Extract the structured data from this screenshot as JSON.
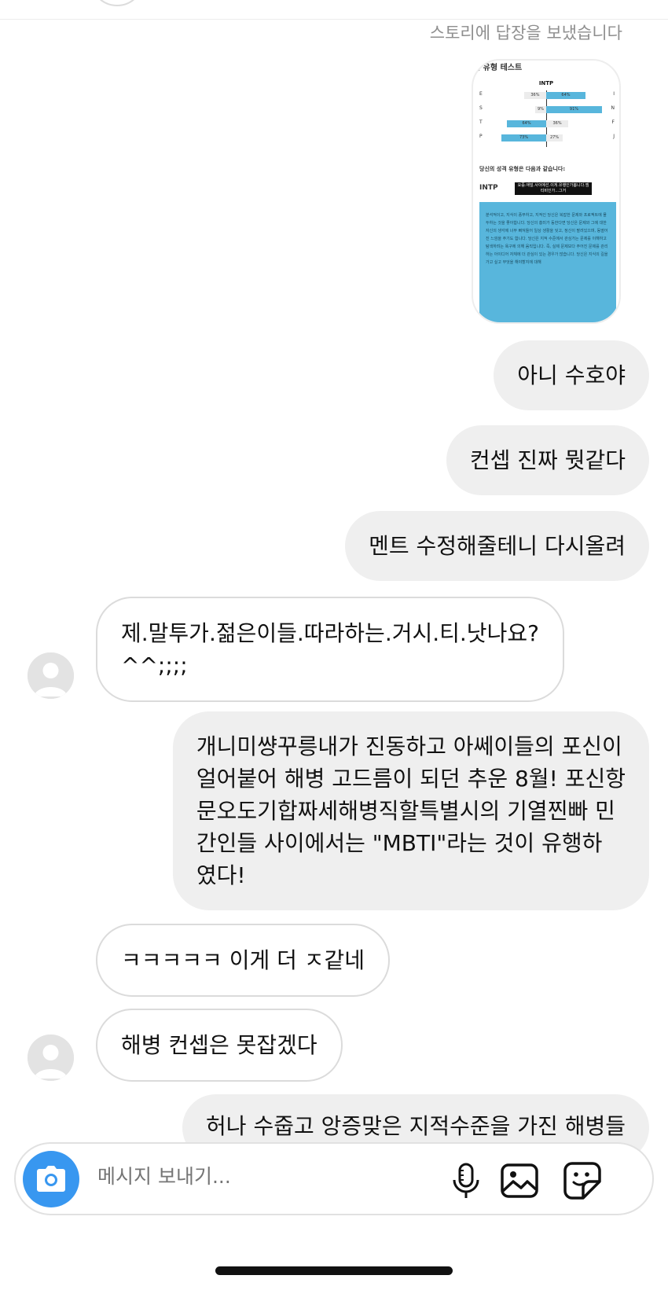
{
  "header": {
    "story_reply_note": "스토리에 답장을 보냈습니다"
  },
  "story_card": {
    "title": "격 유형 테스트",
    "type_label": "INTP",
    "rows": [
      {
        "left": "E",
        "right": "I",
        "left_pct": "36%",
        "right_pct": "64%",
        "left_val": 36,
        "right_val": 64,
        "dominant": "right"
      },
      {
        "left": "S",
        "right": "N",
        "left_pct": "9%",
        "right_pct": "91%",
        "left_val": 9,
        "right_val": 91,
        "dominant": "right"
      },
      {
        "left": "T",
        "right": "F",
        "left_pct": "64%",
        "right_pct": "36%",
        "left_val": 64,
        "right_val": 36,
        "dominant": "left"
      },
      {
        "left": "P",
        "right": "J",
        "left_pct": "73%",
        "right_pct": "27%",
        "left_val": 73,
        "right_val": 27,
        "dominant": "left"
      }
    ],
    "result_heading": "당신의 성격 유형은 다음과 같습니다:",
    "result_type": "INTP",
    "result_tag": "요즘.애덜.사이에선.이게.유행인가봅니다.엠티비인가...그거",
    "description": "분석적이고, 지식이 풍부하고, 지적인 당신은 복잡한 문제와 프로젝트에 몰두하는 것을 좋아합니다. 당신의 흥미가 동한다면 당신은 문제와 그에 대한 자신의 생각에 너무 빠져들어 일상 생활을 잊고, 정신이 팔려있으며, 동떨어진 느낌을 주기도 합니다. 당신은 지적 수준에서 관심가는 문제를 이해하고 탐색하려는 욕구에 의해 움직입니다. 즉, 실제 문제보다 주어진 문제를 관리하는 아이디어 자체에 더 관심이 있는 경우가 많습니다. 당신은 지식의 길을 가고 싶고 무엇을 해야할지에 대해"
  },
  "messages": [
    {
      "id": "m1",
      "side": "out",
      "lines": [
        "아니 수호야"
      ]
    },
    {
      "id": "m2",
      "side": "out",
      "lines": [
        "컨셉 진짜 뭣같다"
      ]
    },
    {
      "id": "m3",
      "side": "out",
      "lines": [
        "멘트 수정해줄테니 다시올려"
      ]
    },
    {
      "id": "m4",
      "side": "in",
      "lines": [
        "제.말투가.젊은이들.따라하는.거시.티.낫나요?",
        "^^;;;;"
      ]
    },
    {
      "id": "m5",
      "side": "out",
      "lines": [
        "개니미썅꾸릉내가 진동하고 아쎄이들의 포신이",
        "얼어붙어 해병 고드름이 되던 추운 8월! 포신항",
        "문오도기합짜세해병직할특별시의 기열찐빠 민",
        "간인들 사이에서는 \"MBTI\"라는 것이 유행하",
        "였다!"
      ]
    },
    {
      "id": "m6",
      "side": "in",
      "lines": [
        "ㅋㅋㅋㅋㅋ 이게 더 ㅈ같네"
      ]
    },
    {
      "id": "m7",
      "side": "in",
      "lines": [
        "해병 컨셉은 못잡겠다"
      ]
    },
    {
      "id": "m8",
      "side": "out",
      "lines": [
        "허나 수줍고 앙증맞은 지적수준을 가진 해병들"
      ]
    }
  ],
  "composer": {
    "placeholder": "메시지 보내기...",
    "icons": [
      "camera-icon",
      "microphone-icon",
      "gallery-icon",
      "sticker-icon"
    ],
    "accent_color": "#3897f0"
  }
}
